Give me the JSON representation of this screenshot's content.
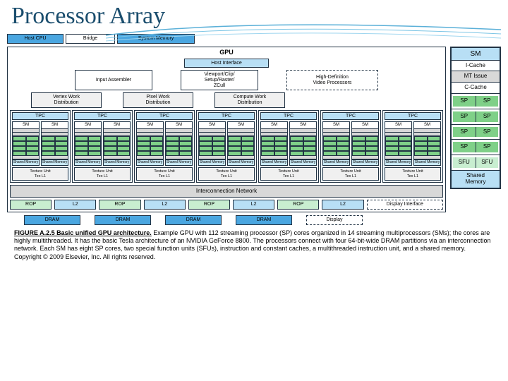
{
  "title": "Processor Array",
  "top": {
    "host": "Host CPU",
    "bridge": "Bridge",
    "sysmem": "System Memory"
  },
  "gpu": {
    "label": "GPU",
    "hostif": "Host Interface",
    "ia": "Input Assembler",
    "vpr": "Viewport/Clip/\nSetup/Raster/\nZCull",
    "hdv": "High-Definition\nVideo Processors",
    "vwd": "Vertex Work\nDistribution",
    "pwd": "Pixel Work\nDistribution",
    "cwd": "Compute Work\nDistribution",
    "tpc": "TPC",
    "sm": "SM",
    "sp": "SP",
    "shmem": "Shared\nMemory",
    "tex": "Texture Unit\nTex L1",
    "inter": "Interconnection Network",
    "rop": "ROP",
    "l2": "L2",
    "dispif": "Display Interface",
    "dram": "DRAM",
    "display": "Display"
  },
  "side": {
    "sm": "SM",
    "icache": "I-Cache",
    "mtissue": "MT Issue",
    "ccache": "C-Cache",
    "sp": "SP",
    "sfu": "SFU",
    "shmem": "Shared\nMemory"
  },
  "caption": {
    "figno": "FIGURE A.2.5 Basic unified GPU architecture.",
    "body": " Example GPU with 112 streaming processor (SP) cores organized in 14 streaming multiprocessors (SMs); the cores are highly multithreaded. It has the basic Tesla architecture of an NVIDIA GeForce 8800. The processors connect with four 64-bit-wide DRAM partitions via an interconnection network. Each SM has eight SP cores, two special function units (SFUs), instruction and constant caches, a multithreaded instruction unit, and a shared memory. Copyright © 2009 Elsevier, Inc. All rights reserved."
  }
}
